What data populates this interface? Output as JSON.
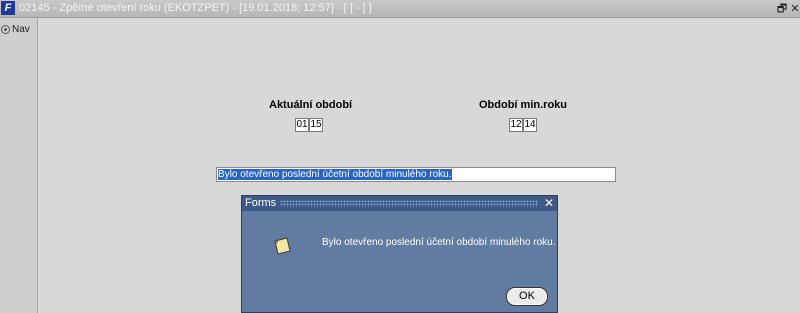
{
  "window": {
    "icon_text": "F",
    "title": "02145 - Zpětné otevření roku (EKOTZPET) - [19.01.2018; 12:57] - [ ] - [ ]",
    "restore_glyph": "🗗",
    "close_glyph": "✕"
  },
  "sidebar": {
    "nav_label": "Nav"
  },
  "form": {
    "current_period": {
      "label": "Aktuální období",
      "month": "01",
      "year": "15"
    },
    "prev_year_period": {
      "label": "Období min.roku",
      "month": "12",
      "year": "14"
    },
    "message": "Bylo otevřeno poslední účetní období minulého roku."
  },
  "dialog": {
    "title": "Forms",
    "close_glyph": "✕",
    "message": "Bylo otevřeno poslední účetní období minulého roku.",
    "ok_label": "OK"
  },
  "colors": {
    "dialog_body": "#617ca0",
    "dialog_title": "#3f5a86",
    "selection": "#2a63c6"
  }
}
